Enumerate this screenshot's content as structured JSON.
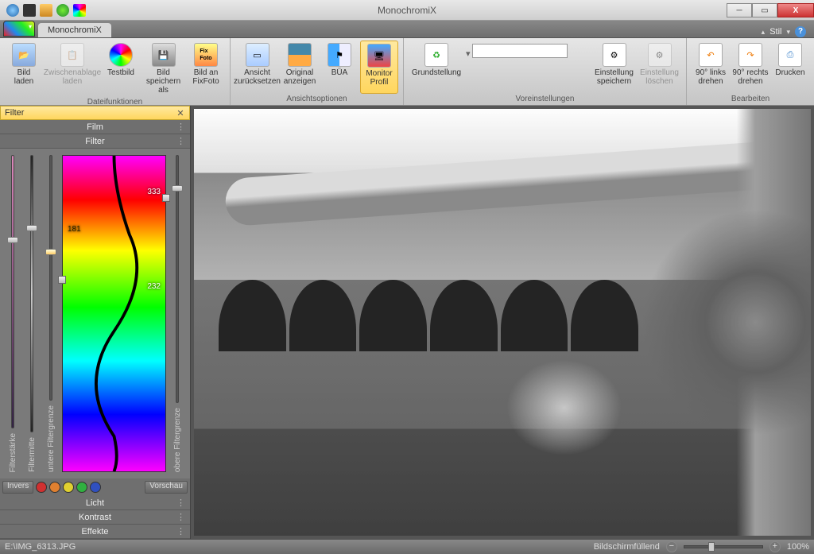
{
  "window": {
    "title": "MonochromiX"
  },
  "menutabs": {
    "main": "MonochromiX",
    "stil": "Stil"
  },
  "ribbon": {
    "groups": {
      "g1": {
        "title": "Dateifunktionen",
        "btns": {
          "load": "Bild\nladen",
          "clip": "Zwischenablage\nladen",
          "test": "Testbild",
          "saveas": "Bild\nspeichern als",
          "fixfoto": "Bild an\nFixFoto"
        }
      },
      "g2": {
        "title": "Ansichtsoptionen",
        "btns": {
          "reset": "Ansicht\nzurücksetzen",
          "orig": "Original\nanzeigen",
          "bua": "BÜA",
          "monitor": "Monitor\nProfil"
        }
      },
      "g3": {
        "title": "Voreinstellungen",
        "btns": {
          "default": "Grundstellung",
          "savepreset": "Einstellung\nspeichern",
          "delpreset": "Einstellung\nlöschen"
        }
      },
      "g4": {
        "title": "Bearbeiten",
        "btns": {
          "rotl": "90° links\ndrehen",
          "rotr": "90° rechts\ndrehen",
          "print": "Drucken"
        }
      }
    }
  },
  "sidebar": {
    "panel_title": "Filter",
    "sections": {
      "film": "Film",
      "filter": "Filter",
      "licht": "Licht",
      "kontrast": "Kontrast",
      "effekte": "Effekte"
    },
    "sliders": {
      "s1": "Filterstärke",
      "s2": "Filtermitte",
      "s3": "untere Filtergrenze",
      "s4": "obere Filtergrenze"
    },
    "spectrum_vals": {
      "v1": "333",
      "v2": "181",
      "v3": "232"
    },
    "palette": {
      "invers": "Invers",
      "vorschau": "Vorschau"
    }
  },
  "status": {
    "path": "E:\\IMG_6313.JPG",
    "fit": "Bildschirmfüllend",
    "zoom": "100%"
  },
  "colors": {
    "swatches": [
      "#d03030",
      "#e08030",
      "#e0d030",
      "#30b040",
      "#3050c0"
    ]
  }
}
